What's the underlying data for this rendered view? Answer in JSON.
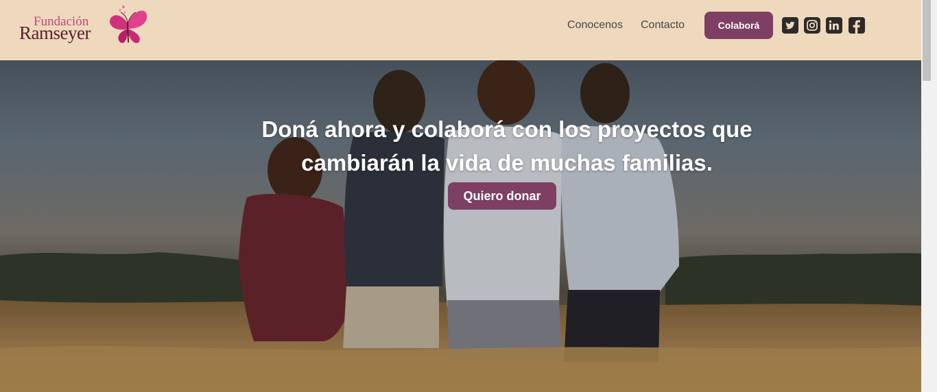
{
  "header": {
    "logo": {
      "line1": "Fundación",
      "line2": "Ramseyer"
    },
    "nav": {
      "conocenos": "Conocenos",
      "contacto": "Contacto"
    },
    "cta_label": "Colaborá",
    "social": [
      "twitter-icon",
      "instagram-icon",
      "linkedin-icon",
      "facebook-icon"
    ]
  },
  "hero": {
    "title": "Doná ahora y colaborá con los proyectos que cambiarán la vida de muchas familias.",
    "button_label": "Quiero donar"
  },
  "colors": {
    "header_bg": "#efd9bd",
    "accent": "#7d3f63",
    "logo_pink": "#c2457b",
    "logo_dark": "#5a1f2e"
  }
}
